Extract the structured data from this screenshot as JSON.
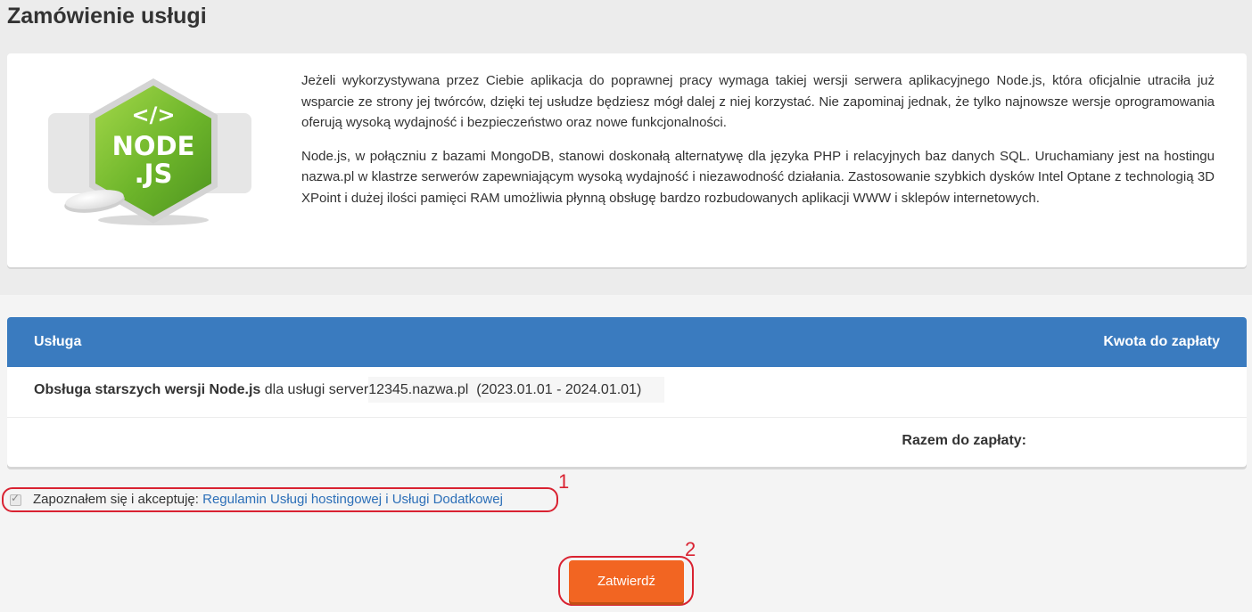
{
  "page": {
    "title": "Zamówienie usługi"
  },
  "info": {
    "logo_label_top": "NODE",
    "logo_label_bottom": ".JS",
    "logo_code": "</>",
    "paragraph1": "Jeżeli wykorzystywana przez Ciebie aplikacja do poprawnej pracy wymaga takiej wersji serwera aplikacyjnego Node.js, która oficjalnie utraciła już wsparcie ze strony jej twórców, dzięki tej usłudze będziesz mógł dalej z niej korzystać. Nie zapominaj jednak, że tylko najnowsze wersje oprogramowania oferują wysoką wydajność i bezpieczeństwo oraz nowe funkcjonalności.",
    "paragraph2": "Node.js, w połączniu z bazami MongoDB, stanowi doskonałą alternatywę dla języka PHP i relacyjnych baz danych SQL. Uruchamiany jest na hostingu nazwa.pl w klastrze serwerów zapewniającym wysoką wydajność i niezawodność działania. Zastosowanie szybkich dysków Intel Optane z technologią 3D XPoint i dużej ilości pamięci RAM umożliwia płynną obsługę bardzo rozbudowanych aplikacji WWW i sklepów internetowych."
  },
  "table": {
    "col_service": "Usługa",
    "col_amount": "Kwota do zapłaty",
    "row": {
      "service_name": "Obsługa starszych wersji Node.js",
      "for_text": " dla usługi server",
      "domain": "12345.nazwa.pl",
      "period": "(2023.01.01 - 2024.01.01)"
    },
    "total_label": "Razem do zapłaty:"
  },
  "terms": {
    "checked": true,
    "check_glyph": "✓",
    "text": "Zapoznałem się i akceptuję: ",
    "link_text": "Regulamin Usługi hostingowej i Usługi Dodatkowej"
  },
  "markers": {
    "m1": "1",
    "m2": "2"
  },
  "submit": {
    "label": "Zatwierdź"
  },
  "colors": {
    "accent": "#3a7bbf",
    "button": "#f26522",
    "highlight": "#d92231",
    "node_green": "#7cc12b"
  }
}
